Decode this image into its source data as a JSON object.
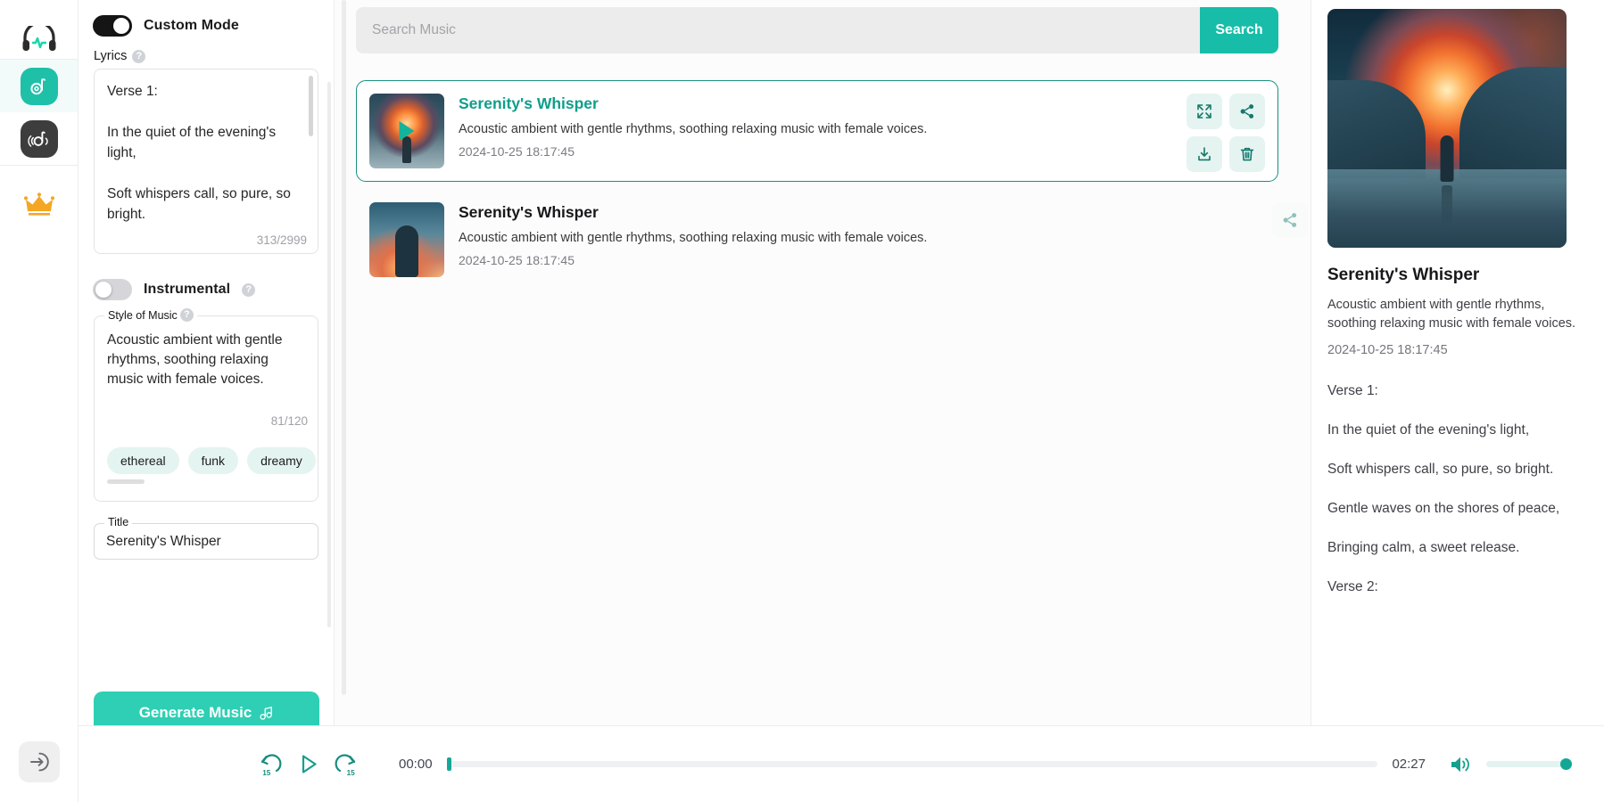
{
  "brand": {
    "accent": "#17bda8",
    "accent_dark": "#0f9e8b",
    "crown_color": "#f5a623"
  },
  "rail": {
    "logo_icon": "headphones-pulse-logo",
    "items": [
      {
        "icon": "music-generate-icon",
        "name": "music-generate",
        "active": true
      },
      {
        "icon": "audio-wave-note-icon",
        "name": "audio-tools",
        "active": false
      }
    ],
    "premium_icon": "crown-icon",
    "collapse_icon": "arrow-into-circle-icon"
  },
  "form": {
    "custom_mode": {
      "label": "Custom Mode",
      "on": true
    },
    "lyrics": {
      "label": "Lyrics",
      "help_icon": "question-mark-icon",
      "value": "Verse 1:\n\nIn the quiet of the evening's light,\n\nSoft whispers call, so pure, so bright.",
      "counter": "313/2999"
    },
    "instrumental": {
      "label": "Instrumental",
      "on": false,
      "help_icon": "question-mark-icon"
    },
    "style_of_music": {
      "legend": "Style of Music",
      "help_icon": "question-mark-icon",
      "value": "Acoustic ambient with gentle rhythms, soothing relaxing music with female voices.",
      "counter": "81/120",
      "tags": [
        "ethereal",
        "funk",
        "dreamy"
      ]
    },
    "title": {
      "legend": "Title",
      "value": "Serenity's Whisper"
    },
    "generate_button": {
      "label": "Generate Music",
      "icon": "music-note-icon"
    }
  },
  "search": {
    "placeholder": "Search Music",
    "value": "",
    "button_label": "Search"
  },
  "results": [
    {
      "title": "Serenity's Whisper",
      "description": "Acoustic ambient with gentle rhythms, soothing relaxing music with female voices.",
      "date": "2024-10-25 18:17:45",
      "selected": true,
      "thumb": "moon-silhouette-artwork",
      "play_icon": "play-icon",
      "actions": [
        {
          "name": "expand-button",
          "icon": "expand-arrows-icon"
        },
        {
          "name": "share-button",
          "icon": "share-icon"
        },
        {
          "name": "download-button",
          "icon": "download-icon"
        },
        {
          "name": "delete-button",
          "icon": "trash-icon"
        }
      ]
    },
    {
      "title": "Serenity's Whisper",
      "description": "Acoustic ambient with gentle rhythms, soothing relaxing music with female voices.",
      "date": "2024-10-25 18:17:45",
      "selected": false,
      "thumb": "woman-sunset-artwork",
      "actions": [
        {
          "name": "share-button",
          "icon": "share-icon"
        }
      ]
    }
  ],
  "detail": {
    "artwork": "moon-silhouette-artwork",
    "title": "Serenity's Whisper",
    "description": "Acoustic ambient with gentle rhythms, soothing relaxing music with female voices.",
    "date": "2024-10-25 18:17:45",
    "lyrics": "Verse 1:\n\nIn the quiet of the evening's light,\n\nSoft whispers call, so pure, so bright.\n\nGentle waves on the shores of peace,\n\nBringing calm, a sweet release.\n\nVerse 2:"
  },
  "player": {
    "rewind_label": "15",
    "forward_label": "15",
    "rewind_icon": "rewind-15-icon",
    "play_icon": "play-icon",
    "forward_icon": "forward-15-icon",
    "current_time": "00:00",
    "total_time": "02:27",
    "progress_percent": 0,
    "volume_icon": "volume-high-icon",
    "volume_percent": 100
  }
}
